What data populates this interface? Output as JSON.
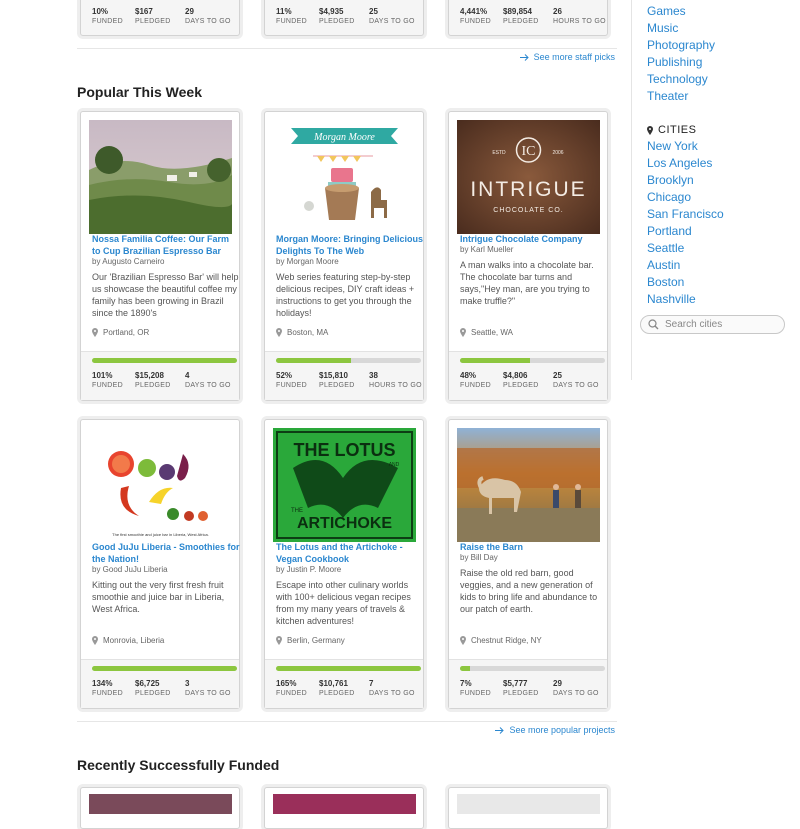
{
  "sidebar": {
    "categories": [
      "Games",
      "Music",
      "Photography",
      "Publishing",
      "Technology",
      "Theater"
    ],
    "cities_heading": "CITIES",
    "cities": [
      "New York",
      "Los Angeles",
      "Brooklyn",
      "Chicago",
      "San Francisco",
      "Portland",
      "Seattle",
      "Austin",
      "Boston",
      "Nashville"
    ],
    "search_placeholder": "Search cities"
  },
  "staff_picks_row": [
    {
      "stats": [
        {
          "v": "10%",
          "l": "FUNDED"
        },
        {
          "v": "$167",
          "l": "PLEDGED"
        },
        {
          "v": "29",
          "l": "DAYS TO GO"
        }
      ]
    },
    {
      "stats": [
        {
          "v": "11%",
          "l": "FUNDED"
        },
        {
          "v": "$4,935",
          "l": "PLEDGED"
        },
        {
          "v": "25",
          "l": "DAYS TO GO"
        }
      ]
    },
    {
      "stats": [
        {
          "v": "4,441%",
          "l": "FUNDED"
        },
        {
          "v": "$89,854",
          "l": "PLEDGED"
        },
        {
          "v": "26",
          "l": "HOURS TO GO"
        }
      ]
    }
  ],
  "see_more_staff": "See more staff picks",
  "popular_heading": "Popular This Week",
  "see_more_popular": "See more popular projects",
  "recent_heading": "Recently Successfully Funded",
  "projects": [
    {
      "title": "Nossa Familia Coffee: Our Farm to Cup Brazilian Espresso Bar",
      "by": "by Augusto Carneiro",
      "blurb": "Our 'Brazilian Espresso Bar' will help us showcase the beautiful coffee my family has been growing in Brazil since the 1890's",
      "location": "Portland, OR",
      "progress": 1.0,
      "stats": [
        {
          "v": "101%",
          "l": "FUNDED"
        },
        {
          "v": "$15,208",
          "l": "PLEDGED"
        },
        {
          "v": "4",
          "l": "DAYS TO GO"
        }
      ]
    },
    {
      "title": "Morgan Moore: Bringing Delicious Delights To The Web",
      "by": "by Morgan Moore",
      "blurb": "Web series featuring step-by-step delicious recipes, DIY craft ideas + instructions to get you through the holidays!",
      "location": "Boston, MA",
      "progress": 0.52,
      "banner": "Morgan Moore",
      "stats": [
        {
          "v": "52%",
          "l": "FUNDED"
        },
        {
          "v": "$15,810",
          "l": "PLEDGED"
        },
        {
          "v": "38",
          "l": "HOURS TO GO"
        }
      ]
    },
    {
      "title": "Intrigue Chocolate Company",
      "by": "by Karl Mueller",
      "blurb": "A man walks into a chocolate bar. The chocolate bar turns and says,\"Hey man, are you trying to make truffle?\"",
      "location": "Seattle, WA",
      "progress": 0.48,
      "logo_word": "INTRIGUE",
      "logo_sub": "CHOCOLATE CO.",
      "logo_estd": "ESTD",
      "logo_year": "2006",
      "stats": [
        {
          "v": "48%",
          "l": "FUNDED"
        },
        {
          "v": "$4,806",
          "l": "PLEDGED"
        },
        {
          "v": "25",
          "l": "DAYS TO GO"
        }
      ]
    },
    {
      "title": "Good JuJu Liberia - Smoothies for the Nation!",
      "by": "by Good JuJu Liberia",
      "blurb": "Kitting out the very first fresh fruit smoothie and juice bar in Liberia, West Africa.",
      "location": "Monrovia, Liberia",
      "progress": 1.0,
      "caption": "The first smoothie and juice bar in Liberia, West Africa.",
      "stats": [
        {
          "v": "134%",
          "l": "FUNDED"
        },
        {
          "v": "$6,725",
          "l": "PLEDGED"
        },
        {
          "v": "3",
          "l": "DAYS TO GO"
        }
      ]
    },
    {
      "title": "The Lotus and the Artichoke - Vegan Cookbook",
      "by": "by Justin P. Moore",
      "blurb": "Escape into other culinary worlds with 100+ delicious vegan recipes from my many years of travels & kitchen adventures!",
      "location": "Berlin, Germany",
      "progress": 1.0,
      "art_top": "THE LOTUS",
      "art_and": "AND",
      "art_the": "THE",
      "art_bottom": "ARTICHOKE",
      "stats": [
        {
          "v": "165%",
          "l": "FUNDED"
        },
        {
          "v": "$10,761",
          "l": "PLEDGED"
        },
        {
          "v": "7",
          "l": "DAYS TO GO"
        }
      ]
    },
    {
      "title": "Raise the Barn",
      "by": "by Bill Day",
      "blurb": "Raise the old red barn, good veggies, and a new generation of kids to bring life and abundance to our patch of earth.",
      "location": "Chestnut Ridge, NY",
      "progress": 0.07,
      "stats": [
        {
          "v": "7%",
          "l": "FUNDED"
        },
        {
          "v": "$5,777",
          "l": "PLEDGED"
        },
        {
          "v": "29",
          "l": "DAYS TO GO"
        }
      ]
    }
  ],
  "colors": {
    "link": "#2b87cf",
    "progress": "#8cc63f",
    "track": "#d8d8d8"
  },
  "icons": {
    "location": "map-pin-icon",
    "more": "arrow-right-icon",
    "search": "search-icon"
  }
}
